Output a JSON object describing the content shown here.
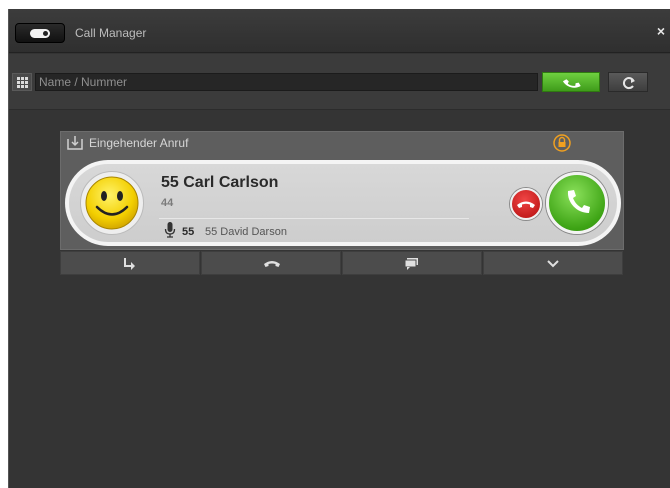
{
  "window": {
    "title": "Call Manager",
    "close_label": "×",
    "toggle_icon": "toggle-icon"
  },
  "search": {
    "placeholder": "Name / Nummer",
    "dialpad_icon": "dialpad-icon",
    "dial_button_icon": "phone-icon",
    "refresh_button_icon": "refresh-icon",
    "accent_color": "#4caf25"
  },
  "call": {
    "header_label": "Eingehender Anruf",
    "header_icon": "download-icon",
    "lock_icon": "lock-icon",
    "caller": {
      "name": "55 Carl Carlson",
      "number": "44",
      "avatar_icon": "smiley-icon"
    },
    "callee": {
      "ext": "55",
      "name": "55 David Darson",
      "icon": "microphone-icon"
    },
    "decline_icon": "phone-hangup-icon",
    "accept_icon": "phone-icon",
    "decline_color": "#d01a1a",
    "accept_color": "#4caf25"
  },
  "actions": [
    {
      "name": "forward",
      "icon": "forward-icon"
    },
    {
      "name": "hangup",
      "icon": "phone-hangup-icon"
    },
    {
      "name": "chat",
      "icon": "chat-icon"
    },
    {
      "name": "more",
      "icon": "chevron-down-icon"
    }
  ]
}
